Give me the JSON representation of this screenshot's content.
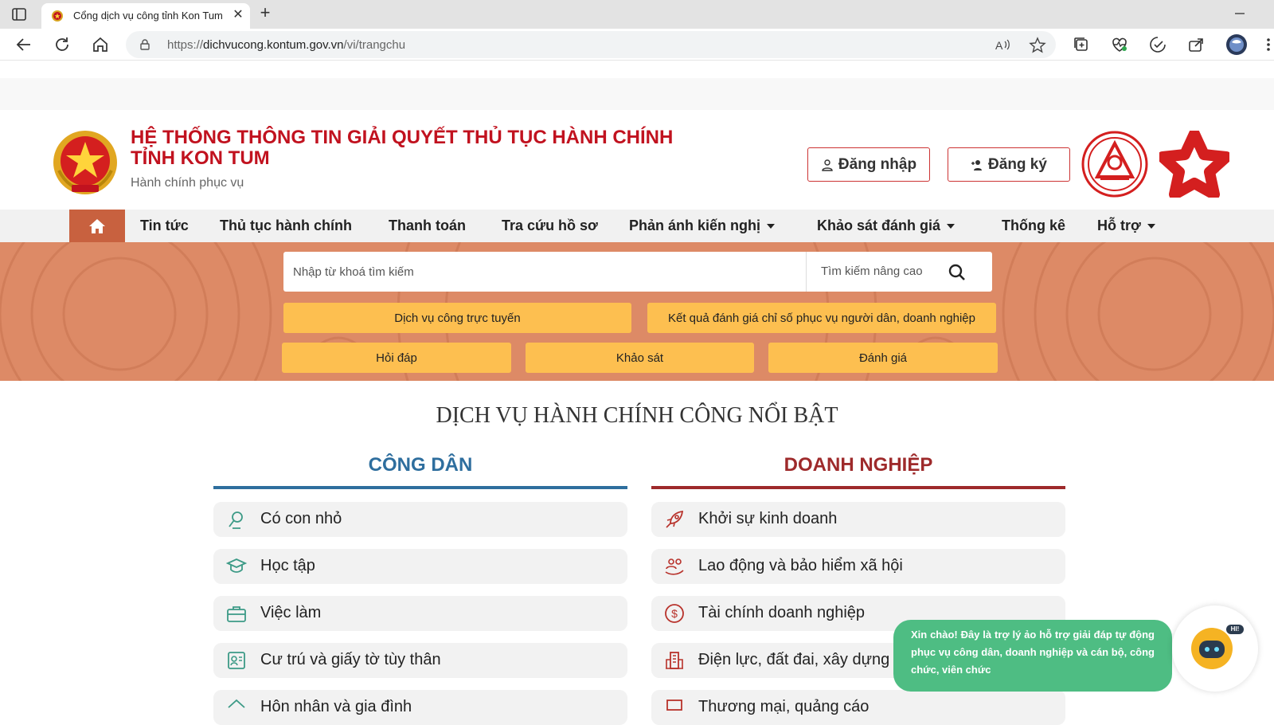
{
  "browser": {
    "tab_title": "Cổng dịch vụ công tỉnh Kon Tum",
    "url_prefix": "https://",
    "url_host": "dichvucong.kontum.gov.vn",
    "url_path": "/vi/trangchu"
  },
  "header": {
    "title_line1": "HỆ THỐNG THÔNG TIN GIẢI QUYẾT THỦ TỤC HÀNH CHÍNH",
    "title_line2": "TỈNH KON TUM",
    "subtitle": "Hành chính phục vụ",
    "login_label": "Đăng nhập",
    "register_label": "Đăng ký"
  },
  "nav": {
    "items": [
      {
        "label": "Tin tức"
      },
      {
        "label": "Thủ tục hành chính"
      },
      {
        "label": "Thanh toán"
      },
      {
        "label": "Tra cứu hồ sơ"
      },
      {
        "label": "Phản ánh kiến nghị"
      },
      {
        "label": "Khảo sát đánh giá"
      },
      {
        "label": "Thống kê"
      },
      {
        "label": "Hỗ trợ"
      }
    ]
  },
  "search": {
    "placeholder": "Nhập từ khoá tìm kiếm",
    "advanced_label": "Tìm kiếm nâng cao"
  },
  "hero_buttons": {
    "online_services": "Dịch vụ công trực tuyến",
    "evaluation_results": "Kết quả đánh giá chỉ số phục vụ người dân, doanh nghiệp",
    "qa": "Hỏi đáp",
    "survey": "Khảo sát",
    "rating": "Đánh giá"
  },
  "services": {
    "section_title": "DỊCH VỤ HÀNH CHÍNH CÔNG NỔI BẬT",
    "citizen_title": "CÔNG DÂN",
    "business_title": "DOANH NGHIỆP",
    "citizen_items": [
      {
        "label": "Có con nhỏ",
        "icon": "baby-icon"
      },
      {
        "label": "Học tập",
        "icon": "graduation-cap-icon"
      },
      {
        "label": "Việc làm",
        "icon": "briefcase-icon"
      },
      {
        "label": "Cư trú và giấy tờ tùy thân",
        "icon": "id-card-icon"
      },
      {
        "label": "Hôn nhân và gia đình",
        "icon": "home-icon"
      }
    ],
    "business_items": [
      {
        "label": "Khởi sự kinh doanh",
        "icon": "rocket-icon"
      },
      {
        "label": "Lao động và bảo hiểm xã hội",
        "icon": "people-icon"
      },
      {
        "label": "Tài chính doanh nghiệp",
        "icon": "dollar-icon"
      },
      {
        "label": "Điện lực, đất đai, xây dựng",
        "icon": "building-icon"
      },
      {
        "label": "Thương mại, quảng cáo",
        "icon": "store-icon"
      }
    ]
  },
  "chat": {
    "message": "Xin chào! Đây là trợ lý ảo hỗ trợ giải đáp tự động phục vụ công dân, doanh nghiệp và cán bộ, công chức, viên chức",
    "badge": "HI!"
  },
  "colors": {
    "brand_red": "#c1121f",
    "nav_home_bg": "#c8613f",
    "hero_bg": "#dd8a66",
    "hero_button": "#fdbf50",
    "citizen_blue": "#2e6e9e",
    "business_red": "#9e2a2b",
    "chat_green": "#4ebd83"
  }
}
